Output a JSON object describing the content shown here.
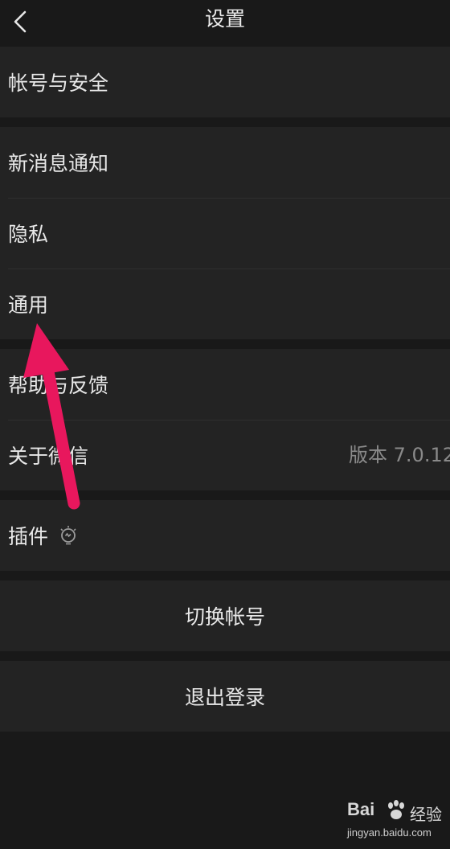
{
  "header": {
    "title": "设置",
    "back_icon": "chevron-left-icon"
  },
  "groups": [
    {
      "items": [
        {
          "label": "帐号与安全"
        }
      ]
    },
    {
      "items": [
        {
          "label": "新消息通知"
        },
        {
          "label": "隐私"
        },
        {
          "label": "通用"
        }
      ]
    },
    {
      "items": [
        {
          "label": "帮助与反馈"
        },
        {
          "label": "关于微信",
          "value": "版本 7.0.12"
        }
      ]
    },
    {
      "items": [
        {
          "label": "插件",
          "icon": "lightbulb-plugin-icon"
        }
      ]
    }
  ],
  "actions": {
    "switch_account": "切换帐号",
    "logout": "退出登录"
  },
  "annotation": {
    "arrow_color": "#e8175d"
  },
  "watermark": {
    "brand": "Bai",
    "suffix": "经验",
    "url": "jingyan.baidu.com"
  },
  "colors": {
    "background": "#191919",
    "cell": "#232323",
    "text": "#e8e8e8",
    "secondary": "#8a8a8a"
  }
}
